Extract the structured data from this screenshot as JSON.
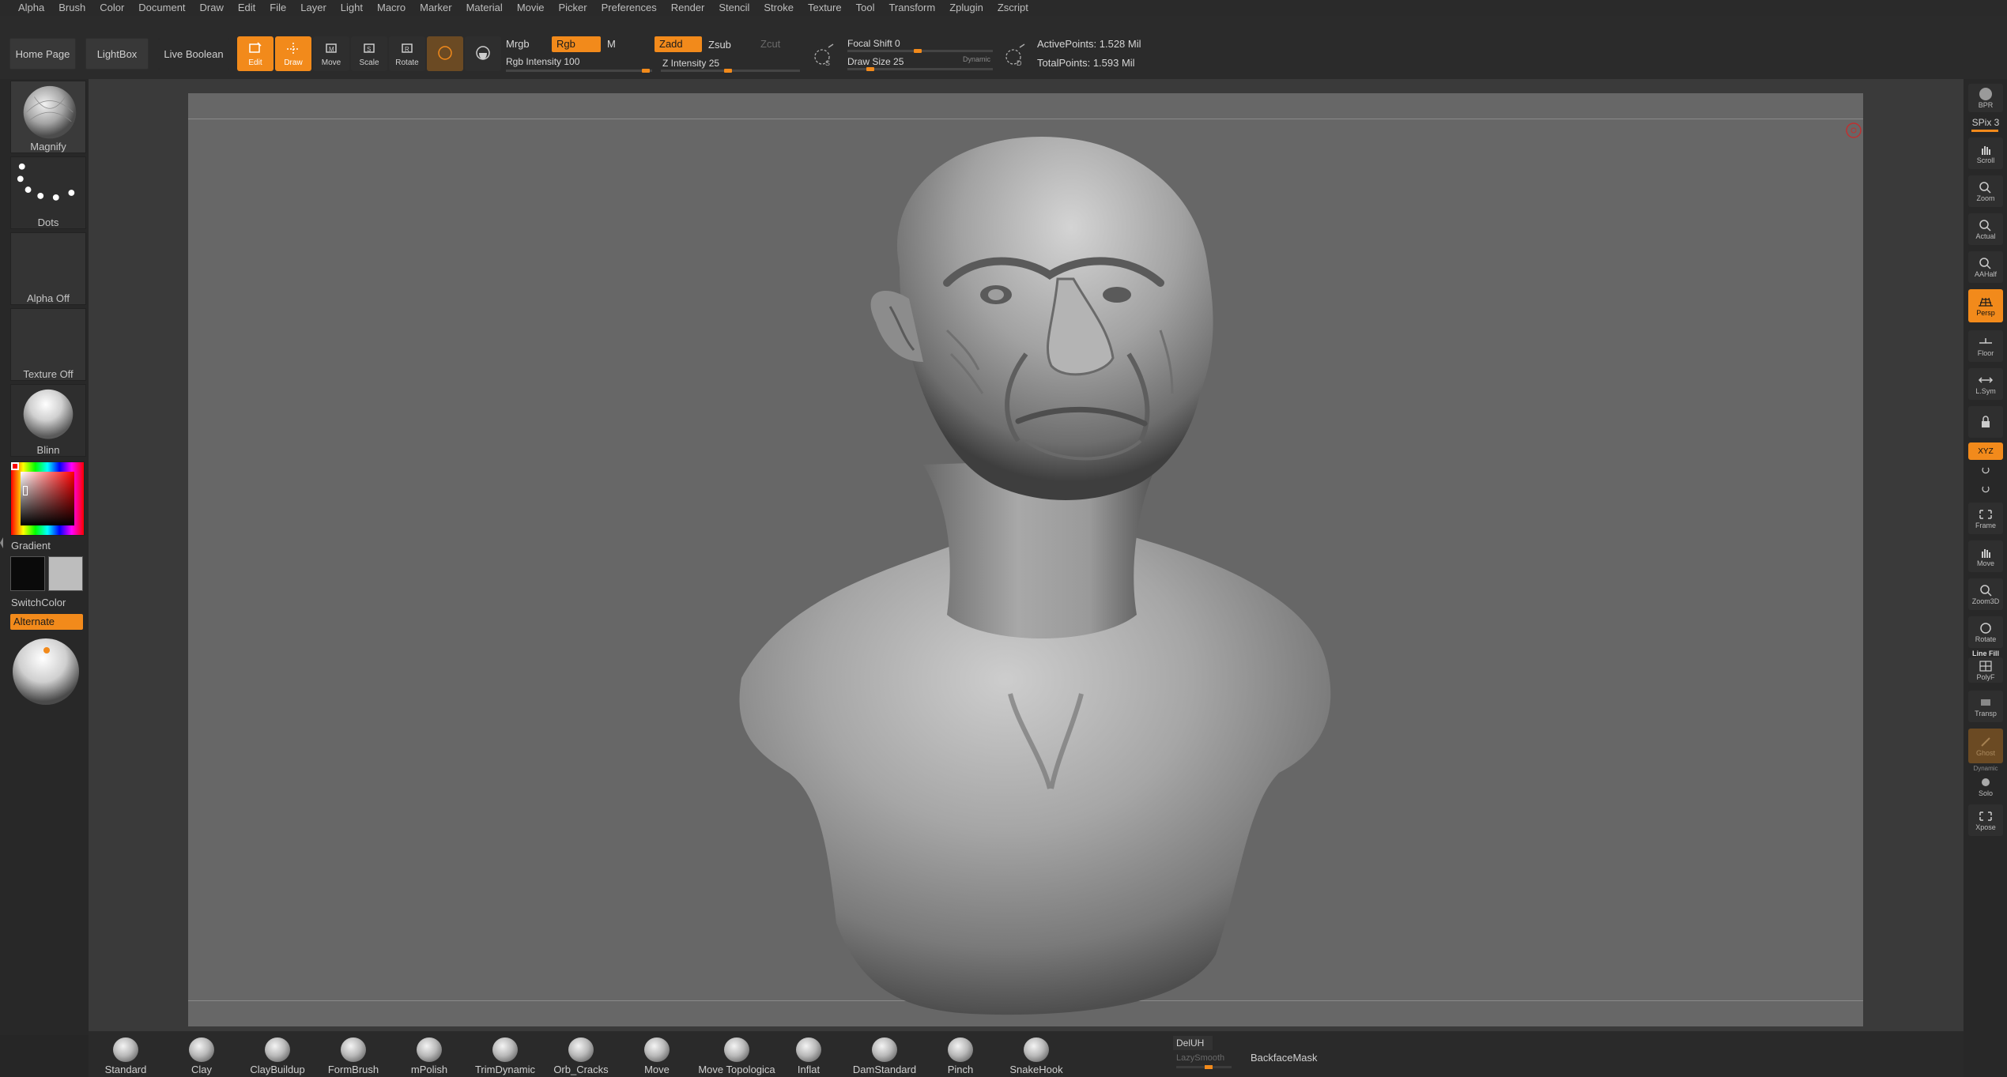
{
  "menu": [
    "Alpha",
    "Brush",
    "Color",
    "Document",
    "Draw",
    "Edit",
    "File",
    "Layer",
    "Light",
    "Macro",
    "Marker",
    "Material",
    "Movie",
    "Picker",
    "Preferences",
    "Render",
    "Stencil",
    "Stroke",
    "Texture",
    "Tool",
    "Transform",
    "Zplugin",
    "Zscript"
  ],
  "shelf": {
    "home_page": "Home Page",
    "lightbox": "LightBox",
    "live_boolean": "Live Boolean",
    "tools": [
      {
        "label": "Edit",
        "active": true
      },
      {
        "label": "Draw",
        "active": true
      },
      {
        "label": "Move",
        "active": false
      },
      {
        "label": "Scale",
        "active": false
      },
      {
        "label": "Rotate",
        "active": false
      }
    ],
    "mrgb": "Mrgb",
    "rgb": "Rgb",
    "m": "M",
    "zadd": "Zadd",
    "zsub": "Zsub",
    "zcut": "Zcut",
    "rgb_intensity": "Rgb Intensity 100",
    "z_intensity": "Z Intensity 25",
    "focal_shift": "Focal Shift 0",
    "draw_size": "Draw Size 25",
    "dynamic": "Dynamic",
    "active_points": "ActivePoints: 1.528 Mil",
    "total_points": "TotalPoints: 1.593 Mil",
    "accent_color": "#f28a1b"
  },
  "left": {
    "brush_label": "Magnify",
    "stroke_label": "Dots",
    "alpha_label": "Alpha Off",
    "texture_label": "Texture Off",
    "material_label": "Blinn",
    "gradient_label": "Gradient",
    "switch_color_label": "SwitchColor",
    "alternate_label": "Alternate",
    "main_color": "#0a0a0a",
    "secondary_color": "#bdbdbd"
  },
  "right": {
    "bpr": "BPR",
    "spix": "SPix 3",
    "buttons": [
      "Scroll",
      "Zoom",
      "Actual",
      "AAHalf",
      "Persp",
      "Floor",
      "L.Sym",
      "",
      "XYZ",
      "",
      "",
      "Frame",
      "Move",
      "Zoom3D",
      "Rotate",
      "PolyF",
      "Transp",
      "Ghost",
      "Solo",
      "Xpose"
    ],
    "line_fill": "Line Fill",
    "dynamic": "Dynamic"
  },
  "bottom": {
    "brushes": [
      "Standard",
      "Clay",
      "ClayBuildup",
      "FormBrush",
      "mPolish",
      "TrimDynamic",
      "Orb_Cracks",
      "Move",
      "Move Topologica",
      "Inflat",
      "DamStandard",
      "Pinch",
      "SnakeHook"
    ],
    "delUH": "DelUH",
    "lazy_smooth": "LazySmooth",
    "backface_mask": "BackfaceMask"
  }
}
